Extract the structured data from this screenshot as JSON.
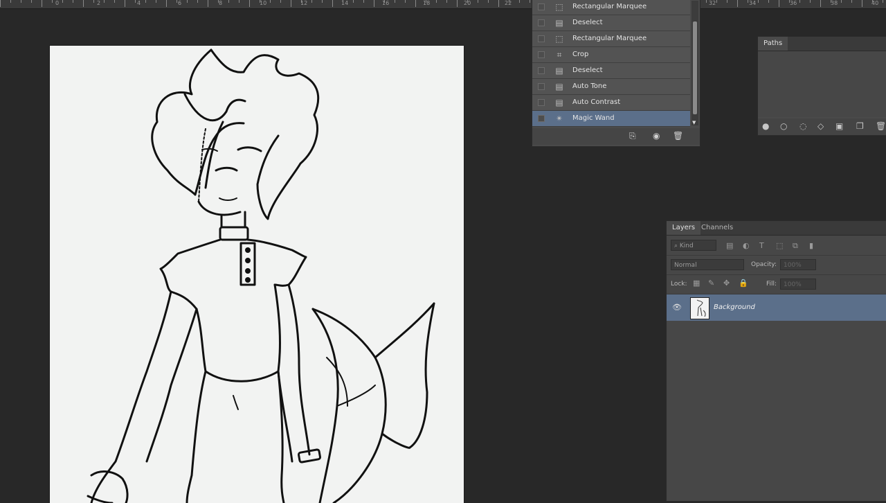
{
  "ruler": {
    "numbers": [
      "0",
      "2",
      "4",
      "6",
      "8",
      "10",
      "12",
      "14",
      "16",
      "18",
      "20",
      "22",
      "32",
      "34",
      "36",
      "38",
      "40"
    ]
  },
  "history": {
    "items": [
      {
        "label": "Rectangular Marquee",
        "icon": "marquee-icon"
      },
      {
        "label": "Deselect",
        "icon": "document-icon"
      },
      {
        "label": "Rectangular Marquee",
        "icon": "marquee-icon"
      },
      {
        "label": "Crop",
        "icon": "crop-icon"
      },
      {
        "label": "Deselect",
        "icon": "document-icon"
      },
      {
        "label": "Auto Tone",
        "icon": "document-icon"
      },
      {
        "label": "Auto Contrast",
        "icon": "document-icon"
      },
      {
        "label": "Magic Wand",
        "icon": "magic-wand-icon"
      }
    ],
    "selected_index": 7
  },
  "paths": {
    "tab": "Paths"
  },
  "layers": {
    "tabs": [
      "Layers",
      "Channels"
    ],
    "filter_kind": "Kind",
    "blend_mode": "Normal",
    "opacity_label": "Opacity:",
    "opacity_value": "100%",
    "lock_label": "Lock:",
    "fill_label": "Fill:",
    "fill_value": "100%",
    "layer_name": "Background"
  },
  "colors": {
    "selection": "#5b6f8a",
    "panel": "#4a4a4a",
    "workspace": "#282828"
  }
}
